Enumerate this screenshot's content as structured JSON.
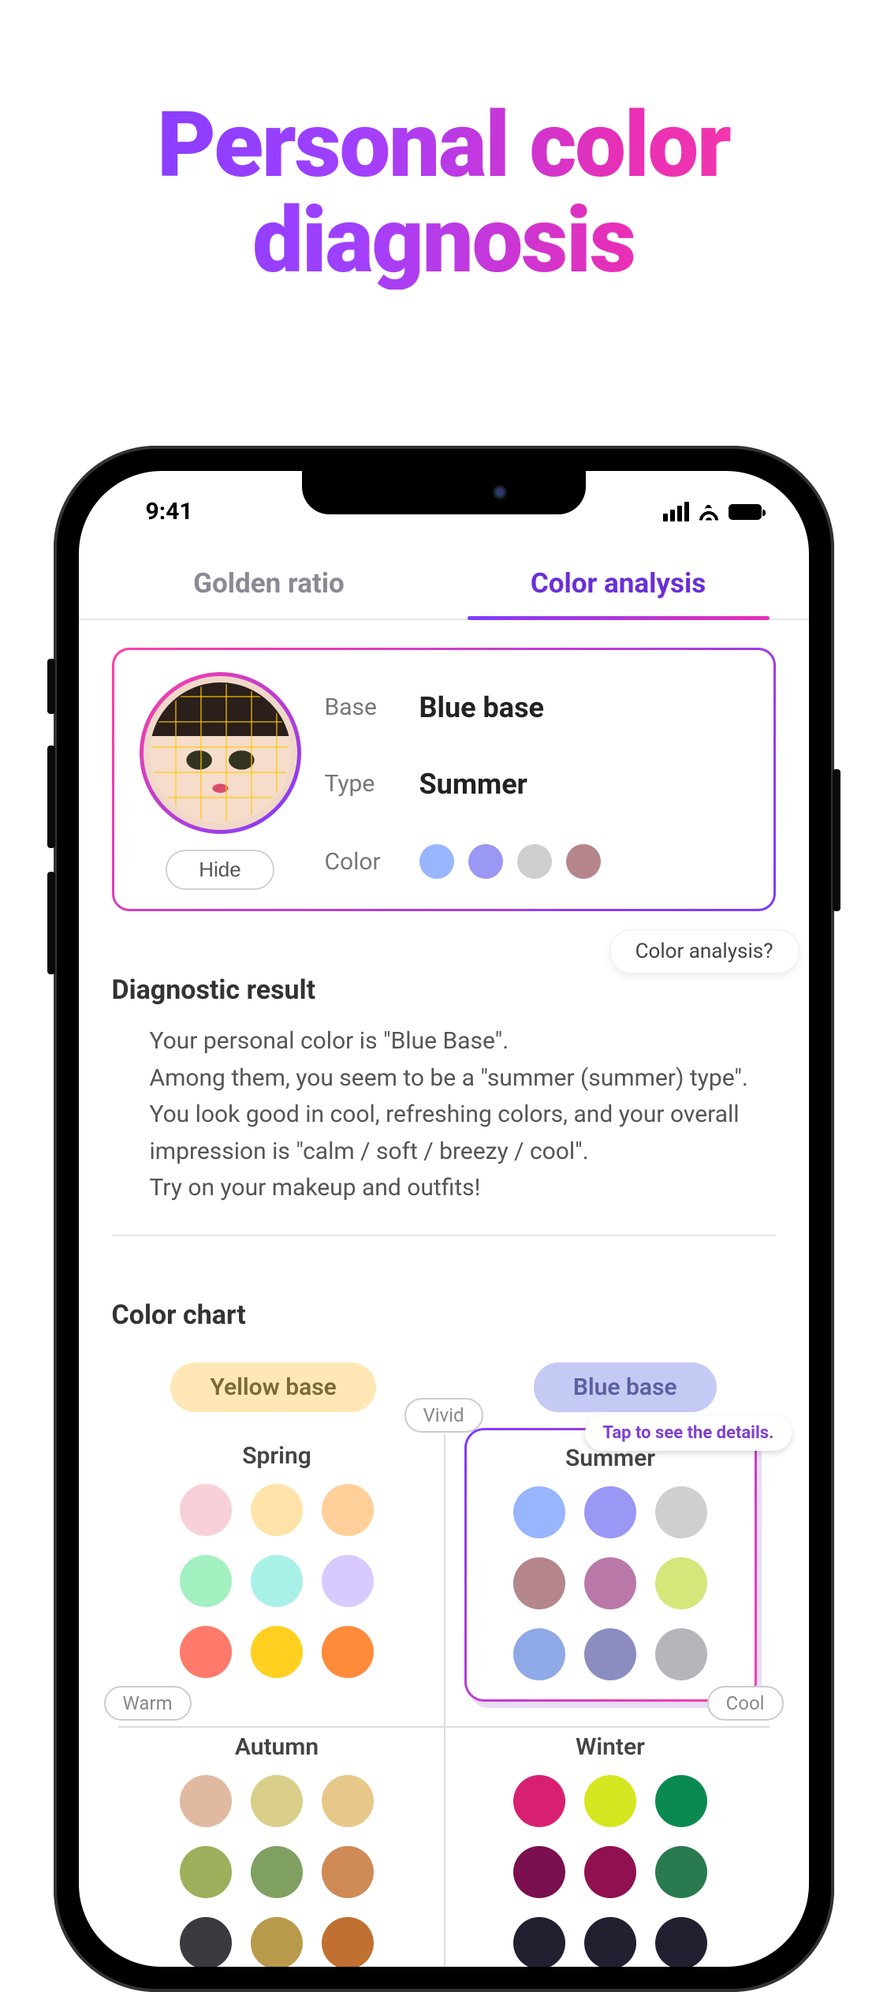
{
  "headline": "Personal color diagnosis",
  "status": {
    "time": "9:41"
  },
  "tabs": {
    "golden_ratio": "Golden ratio",
    "color_analysis": "Color analysis"
  },
  "result": {
    "base_label": "Base",
    "base_value": "Blue base",
    "type_label": "Type",
    "type_value": "Summer",
    "color_label": "Color",
    "swatches": [
      "#97b6ff",
      "#9a97f5",
      "#cfcfd2",
      "#b5868b"
    ],
    "hide_button": "Hide"
  },
  "help_pill": "Color analysis?",
  "diagnostic": {
    "title": "Diagnostic result",
    "line1": "Your personal color is \"Blue Base\".",
    "line2": "Among them, you seem to be a \"summer (summer) type\".",
    "line3": "You look good in cool, refreshing colors, and your overall impression is \"calm / soft / breezy / cool\".",
    "line4": "Try on your makeup and outfits!"
  },
  "chart": {
    "title": "Color chart",
    "yellow_base": "Yellow base",
    "blue_base": "Blue base",
    "axis_vivid": "Vivid",
    "axis_warm": "Warm",
    "axis_cool": "Cool",
    "tooltip": "Tap to see the details.",
    "seasons": {
      "spring": {
        "label": "Spring",
        "colors": [
          "#f8d0d8",
          "#ffe3a8",
          "#ffcf9a",
          "#a3f0c0",
          "#a8f0e8",
          "#d8caff",
          "#ff7a6a",
          "#ffd020",
          "#ff8a3a"
        ]
      },
      "summer": {
        "label": "Summer",
        "colors": [
          "#97b6ff",
          "#9a97f5",
          "#cfcfd2",
          "#b5868b",
          "#b978a8",
          "#d5e67a",
          "#8fa8e6",
          "#8c8cc0",
          "#b5b5bc"
        ]
      },
      "autumn": {
        "label": "Autumn",
        "colors": [
          "#e0b9a0",
          "#d9cf8a",
          "#e8c88a",
          "#9caf5a",
          "#7fa060",
          "#cf8a55",
          "#3a3a40",
          "#b89a4a",
          "#c07030"
        ]
      },
      "winter": {
        "label": "Winter",
        "colors": [
          "#d82070",
          "#d6e620",
          "#0a8a50",
          "#7a1050",
          "#901050",
          "#2a7a50",
          "#202030",
          "#202030",
          "#202030"
        ]
      }
    }
  }
}
